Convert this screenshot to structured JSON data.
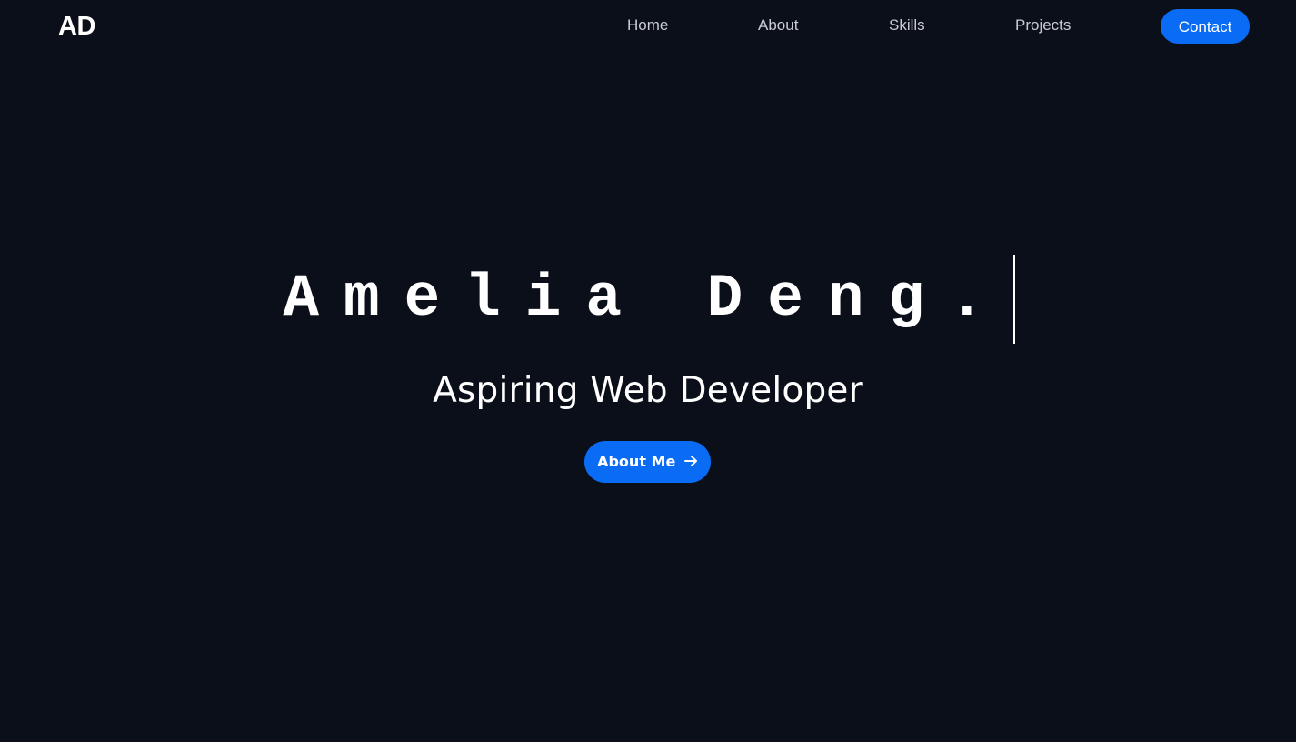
{
  "nav": {
    "logo": "AD",
    "links": [
      {
        "label": "Home"
      },
      {
        "label": "About"
      },
      {
        "label": "Skills"
      },
      {
        "label": "Projects"
      }
    ],
    "contact_label": "Contact"
  },
  "hero": {
    "name": "Amelia Deng.",
    "subtitle": "Aspiring Web Developer",
    "cta_label": "About Me",
    "cta_icon": "arrow-right-icon"
  },
  "colors": {
    "background": "#0b0f1a",
    "accent": "#0a6cf5",
    "text": "#ffffff",
    "nav_text": "#c9ccd3"
  }
}
